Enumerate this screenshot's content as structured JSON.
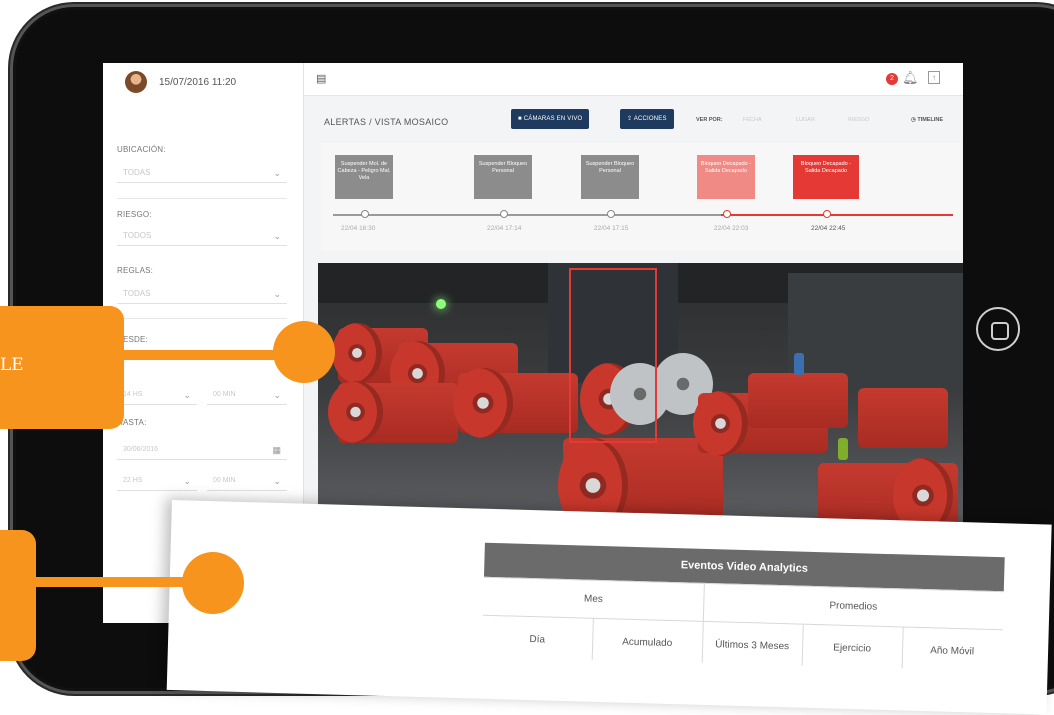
{
  "sidebar": {
    "datetime": "15/07/2016  11:20",
    "ubicacion_label": "UBICACIÓN:",
    "ubicacion_value": "TODAS",
    "riesgo_label": "RIESGO:",
    "riesgo_value": "TODOS",
    "reglas_label": "REGLAS:",
    "reglas_value": "TODAS",
    "desde_label": "DESDE:",
    "desde_hour": "14 HS",
    "desde_min": "00 MIN",
    "hasta_label": "HASTA:",
    "hasta_date": "30/06/2016",
    "hasta_hour": "22 HS",
    "hasta_min": "00 MIN"
  },
  "toolbar": {
    "breadcrumb": "ALERTAS / VISTA MOSAICO",
    "live_button": "CÁMARAS EN VIVO",
    "actions_button": "ACCIONES",
    "view_by": "VER POR:",
    "view_options": [
      "FECHA",
      "LUGAR",
      "RIESGO"
    ],
    "timeline": "TIMELINE"
  },
  "notifications": {
    "count": "2"
  },
  "timeline": {
    "events": [
      {
        "label": "Suspender Mol. de Cabeza - Peligro Mal. Vela",
        "time": "22/04 16:30",
        "color": "#8c8c8c"
      },
      {
        "label": "Suspender Bloqueo Personal",
        "time": "22/04 17:14",
        "color": "#8c8c8c"
      },
      {
        "label": "Suspender Bloqueo Personal",
        "time": "22/04 17:15",
        "color": "#8c8c8c"
      },
      {
        "label": "Bloqueo Decapado - Salida Decapado",
        "time": "22/04 22:03",
        "color": "#ef8a85"
      },
      {
        "label": "Bloqueo Decapado - Salida Decapado",
        "time": "22/04 22:45",
        "color": "#e53935"
      }
    ]
  },
  "report": {
    "title": "Eventos Video Analytics",
    "group_mes": "Mes",
    "group_promedios": "Promedios",
    "columns": [
      "Día",
      "Acumulado",
      "Últimos 3 Meses",
      "Ejercicio",
      "Año Móvil"
    ]
  },
  "callouts": {
    "first_fragment": "LE"
  },
  "colors": {
    "accent_orange": "#f7941d",
    "button_navy": "#1f3a5f",
    "alert_red": "#e53935"
  }
}
